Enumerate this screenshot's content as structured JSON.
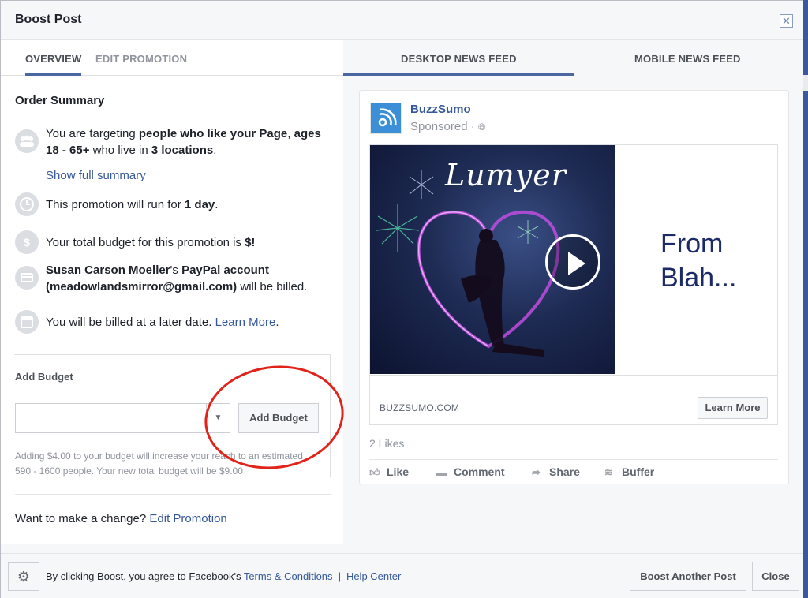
{
  "dialog": {
    "title": "Boost Post",
    "close_icon": "✕"
  },
  "tabs": {
    "left": [
      {
        "label": "OVERVIEW",
        "active": true
      },
      {
        "label": "EDIT PROMOTION",
        "active": false
      }
    ],
    "right": [
      {
        "label": "DESKTOP NEWS FEED",
        "active": true
      },
      {
        "label": "MOBILE NEWS FEED",
        "active": false
      }
    ]
  },
  "order_summary": {
    "title": "Order Summary",
    "targeting": {
      "pre": "You are targeting ",
      "audience": "people who like your Page",
      "comma": ", ",
      "ages": "ages 18 - 65+",
      "mid": " who live in ",
      "locations": "3 locations",
      "end": "."
    },
    "show_full_summary": "Show full summary",
    "duration": {
      "pre": "This promotion will run for ",
      "value": "1 day",
      "end": "."
    },
    "budget": {
      "pre": "Your total budget for this promotion is ",
      "value": "$!"
    },
    "payment": {
      "name": "Susan Carson Moeller",
      "possessive": "'s ",
      "account": "PayPal account",
      "email": "(meadowlandsmirror@gmail.com)",
      "end": " will be billed."
    },
    "billing": {
      "pre": "You will be billed at a later date. ",
      "link": "Learn More",
      "end": "."
    }
  },
  "add_budget": {
    "label": "Add Budget",
    "select_value": "",
    "button": "Add Budget",
    "note_line1": "Adding $4.00 to your budget will increase your reach to an estimated",
    "note_line2": "590 - 1600 people. Your new total budget will be $9.00"
  },
  "change": {
    "pre": "Want to make a change? ",
    "link": "Edit Promotion"
  },
  "preview": {
    "page_name": "BuzzSumo",
    "sponsored": "Sponsored · ",
    "video_title": "Lumyer",
    "side_text_line1": "From",
    "side_text_line2": "Blah...",
    "domain": "BUZZSUMO.COM",
    "cta": "Learn More",
    "likes": "2 Likes",
    "actions": [
      {
        "label": "Like",
        "icon": "thumbs-up-icon"
      },
      {
        "label": "Comment",
        "icon": "comment-icon"
      },
      {
        "label": "Share",
        "icon": "share-icon"
      },
      {
        "label": "Buffer",
        "icon": "buffer-icon"
      }
    ]
  },
  "footer": {
    "text": "By clicking Boost, you agree to Facebook's ",
    "terms": "Terms & Conditions",
    "separator": "|",
    "help": "Help Center",
    "boost_another": "Boost Another Post",
    "close": "Close"
  }
}
